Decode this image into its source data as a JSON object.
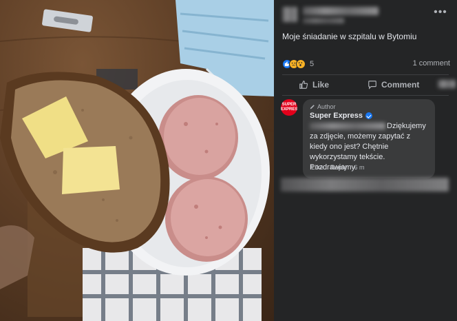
{
  "post": {
    "text": "Moje śniadanie w szpitalu w Bytomiu",
    "reaction_count": "5",
    "comment_count": "1 comment",
    "reactions": [
      "like-icon",
      "sad-icon",
      "wow-icon"
    ]
  },
  "actions": {
    "like_label": "Like",
    "comment_label": "Comment"
  },
  "comment": {
    "author_badge": "Author",
    "name": "Super Express",
    "avatar_text": "SUPER EXPRESS",
    "text": "Dziękujemy za zdjęcie, możemy zapytać z kiedy ono jest? Chętnie wykorzystamy tekście. Pozdrawiamy.",
    "like_label": "Like",
    "reply_label": "Reply",
    "time": "6 m"
  },
  "colors": {
    "panel_bg": "#242526",
    "bubble_bg": "#3a3b3c",
    "accent": "#1877f2",
    "brand_red": "#e3001b"
  }
}
